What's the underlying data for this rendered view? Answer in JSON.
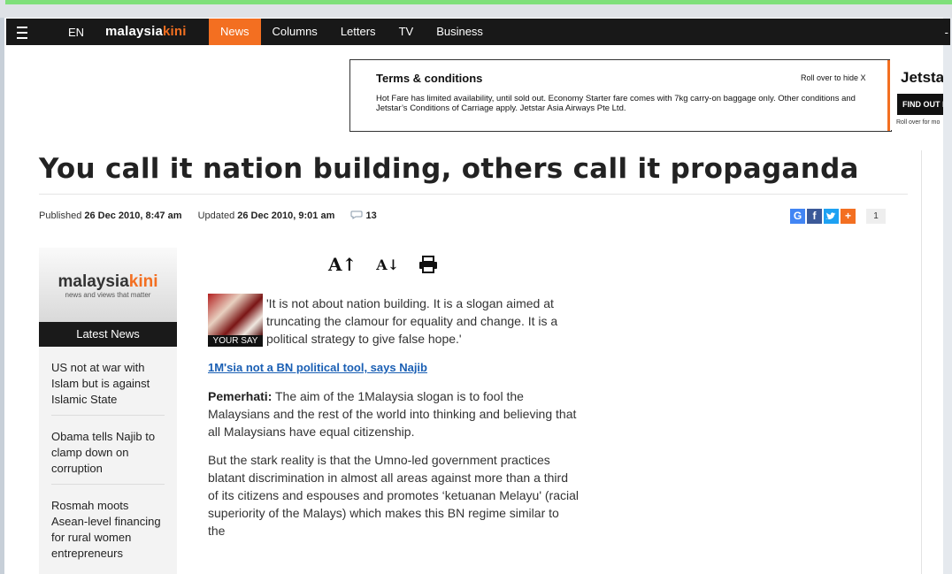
{
  "nav": {
    "language": "EN",
    "logo_part1": "malaysia",
    "logo_part2": "kini",
    "items": [
      "News",
      "Columns",
      "Letters",
      "TV",
      "Business"
    ],
    "active_item": "News",
    "right_glyph": "-"
  },
  "ad": {
    "title": "Terms & conditions",
    "roll_hide": "Roll over to hide X",
    "text": "Hot Fare has limited availability, until sold out. Economy Starter fare comes with 7kg carry-on baggage only. Other conditions and Jetstar’s Conditions of Carriage apply. Jetstar Asia Airways Pte Ltd.",
    "brand": "Jetsta",
    "cta": "FIND OUT M",
    "roll_more": "Roll over for mo"
  },
  "article": {
    "title": "You call it nation building, others call it propaganda",
    "published_label": "Published",
    "published_date": "26 Dec 2010, 8:47 am",
    "updated_label": "Updated",
    "updated_date": "26 Dec 2010, 9:01 am",
    "comment_count": "13",
    "share_count": "1",
    "thumb_label": "YOUR SAY",
    "lead": "'It is not about nation building. It is a slogan aimed at truncating the clamour for equality and change. It is a political strategy to give false hope.'",
    "link": "1M'sia not a BN political tool, says Najib",
    "p1_author": "Pemerhati:",
    "p1_text": " The aim of the 1Malaysia slogan is to fool the Malaysians and the rest of the world into thinking and believing that all Malaysians have equal citizenship.",
    "p2_text": "But the stark reality is that the Umno-led government practices blatant discrimination in almost all areas against more than a third of its citizens and espouses and promotes ‘ketuanan Melayu' (racial superiority of the Malays) which makes this BN regime similar to the"
  },
  "tools": {
    "increase": "A↑",
    "decrease": "A↓",
    "print_icon": "printer-icon"
  },
  "sidebar": {
    "logo_part1": "malaysia",
    "logo_part2": "kini",
    "tagline": "news and views that matter",
    "heading": "Latest News",
    "items": [
      "US not at war with Islam but is against Islamic State",
      "Obama tells Najib to clamp down on corruption",
      "Rosmah moots Asean-level financing for rural women entrepreneurs"
    ]
  },
  "share_icons": [
    "google-icon",
    "facebook-icon",
    "twitter-icon",
    "plus-icon"
  ],
  "colors": {
    "brand_orange": "#f36f21",
    "nav_bg": "#181818",
    "google": "#4285f4",
    "facebook": "#3b5998",
    "twitter": "#1da1f2",
    "plus": "#f36f21"
  }
}
